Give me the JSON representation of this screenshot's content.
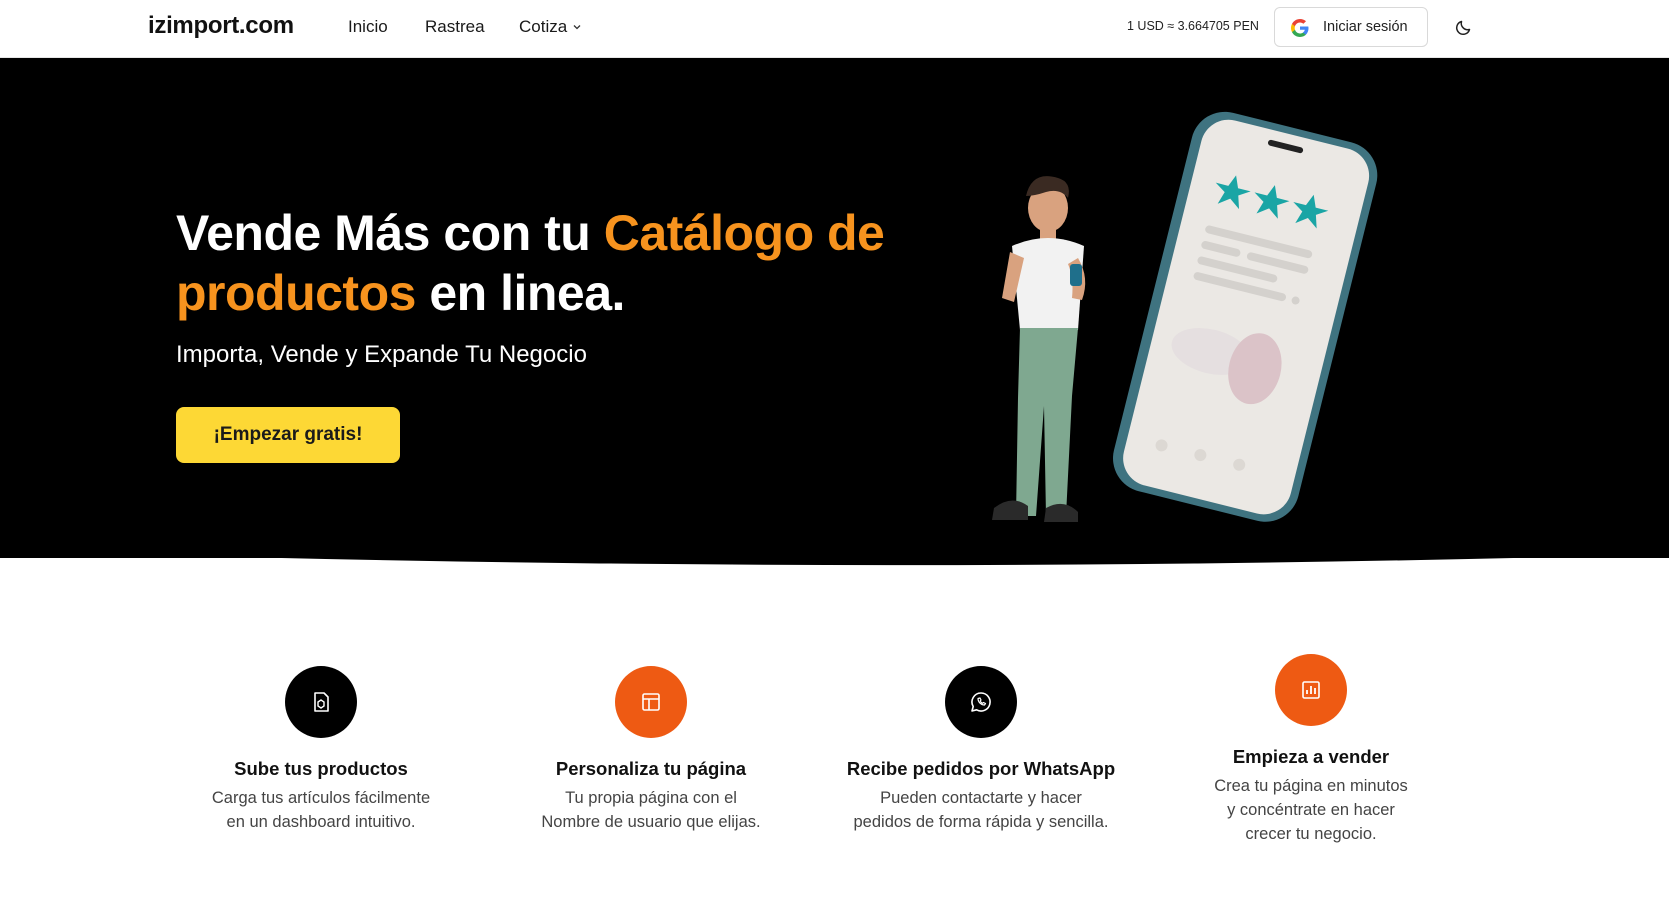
{
  "navbar": {
    "logo": "izimport.com",
    "links": [
      "Inicio",
      "Rastrea",
      "Cotiza"
    ],
    "exchange_rate": "1 USD ≈ 3.664705 PEN",
    "login_label": "Iniciar sesión",
    "icons": {
      "google": "google-icon",
      "theme": "moon-icon",
      "dropdown": "chevron-down-icon"
    }
  },
  "hero": {
    "title_part1": "Vende Más con tu ",
    "title_accent": "Catálogo de productos",
    "title_part2": " en linea.",
    "subtitle": "Importa, Vende y Expande Tu Negocio",
    "cta_label": "¡Empezar gratis!"
  },
  "features": [
    {
      "icon": "package-icon",
      "title": "Sube tus productos",
      "desc_line1": "Carga tus artículos fácilmente",
      "desc_line2": "en un dashboard intuitivo."
    },
    {
      "icon": "layout-icon",
      "title": "Personaliza tu página",
      "desc_line1": "Tu propia página con el",
      "desc_line2": "Nombre de usuario que elijas."
    },
    {
      "icon": "whatsapp-icon",
      "title": "Recibe pedidos por WhatsApp",
      "desc_line1": "Pueden contactarte y hacer",
      "desc_line2": "pedidos de forma rápida y sencilla."
    },
    {
      "icon": "chart-icon",
      "title": "Empieza a vender",
      "desc_line1": "Crea tu página en minutos",
      "desc_line2": "y concéntrate en hacer",
      "desc_line3": "crecer tu negocio."
    }
  ],
  "colors": {
    "accent_orange": "#f7931e",
    "cta_yellow": "#fdd835",
    "icon_orange": "#ee5a13",
    "hero_bg": "#000000"
  }
}
